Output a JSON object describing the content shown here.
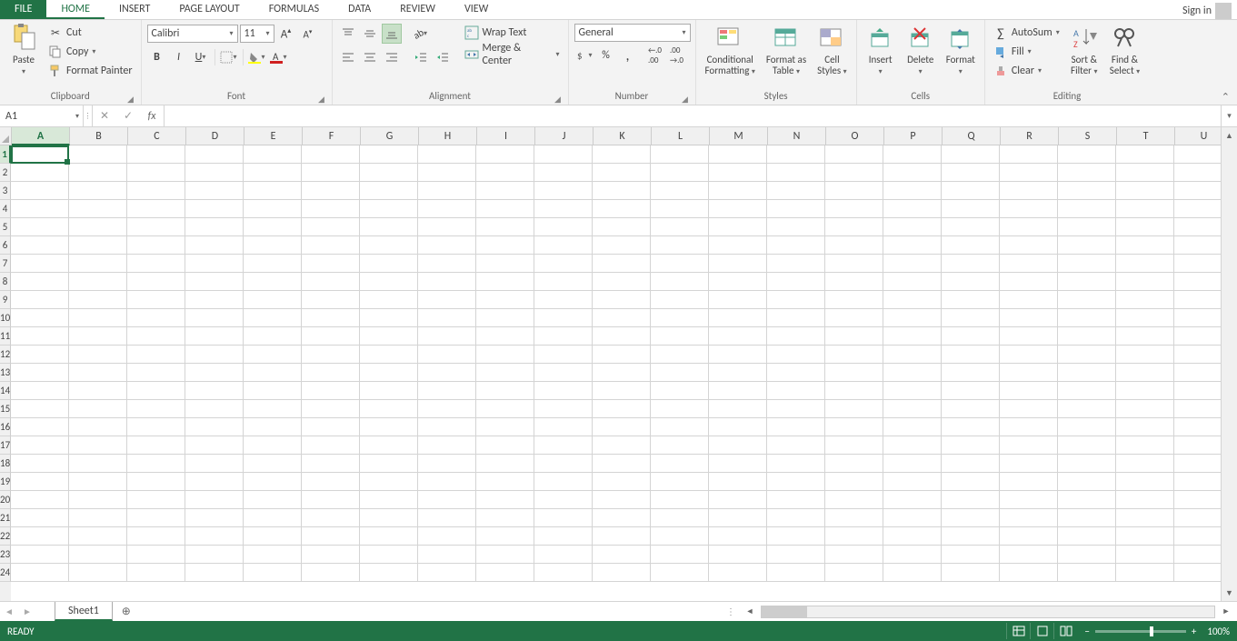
{
  "tabs": {
    "file": "FILE",
    "items": [
      "HOME",
      "INSERT",
      "PAGE LAYOUT",
      "FORMULAS",
      "DATA",
      "REVIEW",
      "VIEW"
    ],
    "active": "HOME",
    "signin": "Sign in"
  },
  "ribbon": {
    "clipboard": {
      "label": "Clipboard",
      "paste": "Paste",
      "cut": "Cut",
      "copy": "Copy",
      "format_painter": "Format Painter"
    },
    "font": {
      "label": "Font",
      "name": "Calibri",
      "size": "11"
    },
    "alignment": {
      "label": "Alignment",
      "wrap": "Wrap Text",
      "merge": "Merge & Center"
    },
    "number": {
      "label": "Number",
      "format": "General"
    },
    "styles": {
      "label": "Styles",
      "conditional": "Conditional\nFormatting",
      "table": "Format as\nTable",
      "cell": "Cell\nStyles"
    },
    "cells": {
      "label": "Cells",
      "insert": "Insert",
      "delete": "Delete",
      "format": "Format"
    },
    "editing": {
      "label": "Editing",
      "autosum": "AutoSum",
      "fill": "Fill",
      "clear": "Clear",
      "sort": "Sort &\nFilter",
      "find": "Find &\nSelect"
    }
  },
  "formula_bar": {
    "name_box": "A1",
    "formula": ""
  },
  "grid": {
    "columns": [
      "A",
      "B",
      "C",
      "D",
      "E",
      "F",
      "G",
      "H",
      "I",
      "J",
      "K",
      "L",
      "M",
      "N",
      "O",
      "P",
      "Q",
      "R",
      "S",
      "T",
      "U"
    ],
    "rows": 24,
    "active_cell": "A1"
  },
  "sheets": {
    "active": "Sheet1"
  },
  "status": {
    "mode": "READY",
    "zoom": "100%"
  }
}
